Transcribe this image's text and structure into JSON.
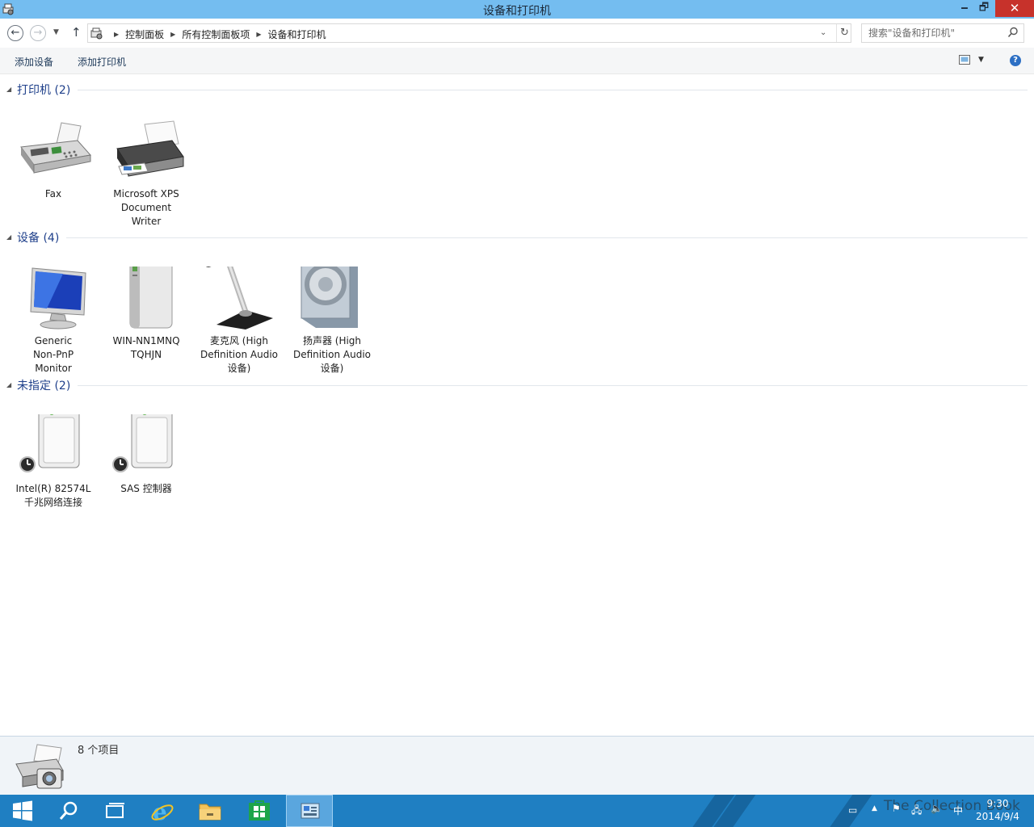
{
  "window": {
    "title": "设备和打印机",
    "minimize_glyph": "🗕",
    "restore_glyph": "🗗",
    "close_glyph": "✕"
  },
  "address": {
    "crumbs": [
      "控制面板",
      "所有控制面板项",
      "设备和打印机"
    ],
    "search_placeholder": "搜索\"设备和打印机\""
  },
  "toolbar": {
    "add_device": "添加设备",
    "add_printer": "添加打印机",
    "help": "?"
  },
  "groups": [
    {
      "label": "打印机 (2)",
      "items": [
        {
          "lines": [
            "Fax"
          ],
          "icon": "fax-icon"
        },
        {
          "lines": [
            "Microsoft XPS",
            "Document",
            "Writer"
          ],
          "icon": "printer-icon"
        }
      ]
    },
    {
      "label": "设备 (4)",
      "items": [
        {
          "lines": [
            "Generic",
            "Non-PnP",
            "Monitor"
          ],
          "icon": "monitor-icon"
        },
        {
          "lines": [
            "WIN-NN1MNQ",
            "TQHJN"
          ],
          "icon": "computer-icon"
        },
        {
          "lines": [
            "麦克风 (High",
            "Definition Audio",
            "设备)"
          ],
          "icon": "microphone-icon"
        },
        {
          "lines": [
            "扬声器 (High",
            "Definition Audio",
            "设备)"
          ],
          "icon": "speaker-icon"
        }
      ]
    },
    {
      "label": "未指定 (2)",
      "items": [
        {
          "lines": [
            "Intel(R) 82574L",
            "千兆网络连接"
          ],
          "icon": "device-unspecified-icon"
        },
        {
          "lines": [
            "SAS 控制器"
          ],
          "icon": "device-unspecified-icon"
        }
      ]
    }
  ],
  "details": {
    "count": "8 个项目"
  },
  "taskbar": {
    "time": "9:30",
    "date": "2014/9/4",
    "ime": "中",
    "watermark": "The Collection Book"
  }
}
